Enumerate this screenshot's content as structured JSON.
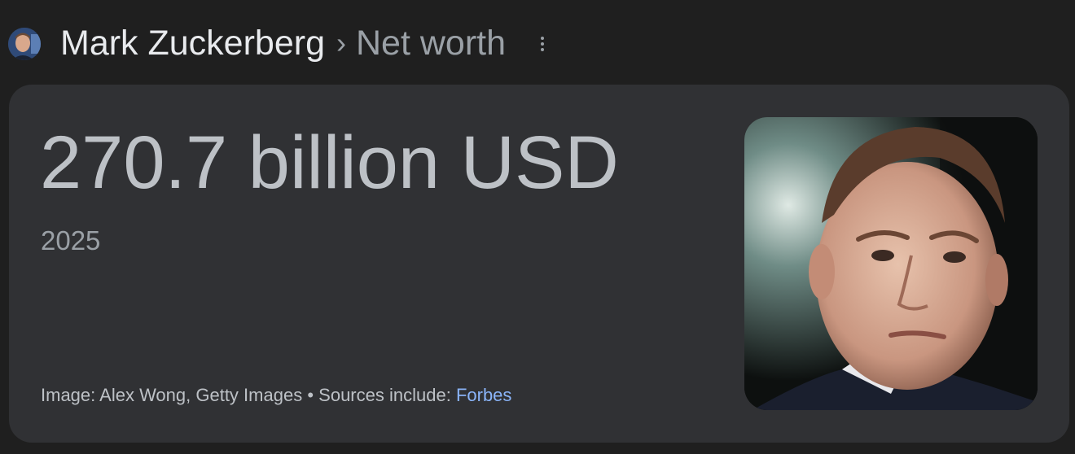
{
  "header": {
    "name": "Mark Zuckerberg",
    "separator": "›",
    "subtitle": "Net worth",
    "avatar_icon": "person-avatar",
    "more_icon": "more-vert-icon"
  },
  "result": {
    "value": "270.7 billion USD",
    "year": "2025",
    "image_credit": "Image: Alex Wong, Getty Images",
    "bullet": "•",
    "sources_label": "Sources include:",
    "source_link": "Forbes"
  },
  "colors": {
    "page_background": "#1f1f1f",
    "card_background": "#303134",
    "primary_text": "#e8eaed",
    "secondary_text": "#9aa0a6",
    "link": "#8ab4f8"
  }
}
